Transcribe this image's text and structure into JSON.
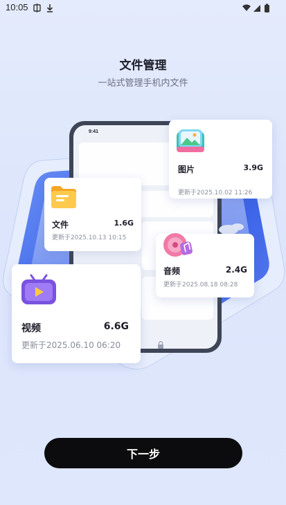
{
  "status_bar": {
    "time": "10:05"
  },
  "header": {
    "title": "文件管理",
    "subtitle": "一站式管理手机内文件"
  },
  "phone_mock": {
    "time": "9:41"
  },
  "cards": {
    "pictures": {
      "name": "图片",
      "size": "3.9G",
      "date": "更新于2025.10.02  11:26"
    },
    "documents": {
      "name": "文件",
      "size": "1.6G",
      "date": "更新于2025.10.13  10:15"
    },
    "audio": {
      "name": "音频",
      "size": "2.4G",
      "date": "更新于2025.08.18  08:28"
    },
    "video": {
      "name": "视频",
      "size": "6.6G",
      "date": "更新于2025.06.10  06:20"
    }
  },
  "footer": {
    "next_label": "下一步"
  },
  "colors": {
    "background": "#e1e9fc",
    "accent_blue": "#3a63e8",
    "button": "#0c0c0e"
  }
}
